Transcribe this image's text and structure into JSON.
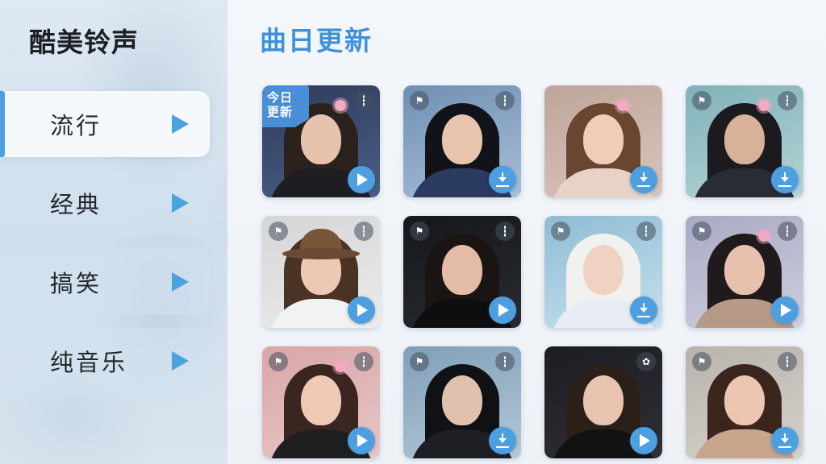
{
  "app": {
    "title": "酷美铃声"
  },
  "sidebar": {
    "items": [
      {
        "label": "流行",
        "active": true
      },
      {
        "label": "经典",
        "active": false
      },
      {
        "label": "搞笑",
        "active": false
      },
      {
        "label": "纯音乐",
        "active": false
      }
    ]
  },
  "main": {
    "section_title": "曲日更新",
    "badge_line1": "今日",
    "badge_line2": "更新",
    "cards": [
      {
        "action": "play",
        "left_icon": "",
        "right_icon": "mute-icon",
        "bg": [
          "#2f3a5a",
          "#4a5f86"
        ],
        "hair": "#2b211d",
        "skin": "#e7c2ad",
        "cloth": "#1e1e22",
        "hat": false,
        "flower": true
      },
      {
        "action": "download",
        "left_icon": "flag-icon",
        "right_icon": "mute-icon",
        "bg": [
          "#6f8fb3",
          "#a8c0d8"
        ],
        "hair": "#111318",
        "skin": "#e6c4ae",
        "cloth": "#2a3a60",
        "hat": false,
        "flower": false
      },
      {
        "action": "download",
        "left_icon": "",
        "right_icon": "",
        "bg": [
          "#bfa59b",
          "#d8c5bc"
        ],
        "hair": "#6a4530",
        "skin": "#efcdb8",
        "cloth": "#e8d2c5",
        "hat": false,
        "flower": true
      },
      {
        "action": "download",
        "left_icon": "flag-icon",
        "right_icon": "mute-icon",
        "bg": [
          "#7fb1b8",
          "#b4d5d6"
        ],
        "hair": "#1b1b1f",
        "skin": "#d9b09a",
        "cloth": "#2a2c33",
        "hat": false,
        "flower": true
      },
      {
        "action": "play",
        "left_icon": "flag-icon",
        "right_icon": "mute-icon",
        "bg": [
          "#d5d5d5",
          "#ececec"
        ],
        "hair": "#4a3224",
        "skin": "#ecc9b4",
        "cloth": "#f2f2f2",
        "hat": true,
        "flower": false
      },
      {
        "action": "play",
        "left_icon": "flag-icon",
        "right_icon": "mute-icon",
        "bg": [
          "#16171b",
          "#2a2b30"
        ],
        "hair": "#1a1412",
        "skin": "#e3bba6",
        "cloth": "#0e0e10",
        "hat": false,
        "flower": false
      },
      {
        "action": "download",
        "left_icon": "flag-icon",
        "right_icon": "mute-icon",
        "bg": [
          "#8fbcd4",
          "#c7e0ee"
        ],
        "hair": "#f1f1ef",
        "skin": "#f0d2c2",
        "cloth": "#e7edf2",
        "hat": false,
        "flower": false
      },
      {
        "action": "play",
        "left_icon": "flag-icon",
        "right_icon": "mute-icon",
        "bg": [
          "#a9a9c2",
          "#cfcfe0"
        ],
        "hair": "#201a1c",
        "skin": "#e7c1ad",
        "cloth": "#b79a86",
        "hat": false,
        "flower": true
      },
      {
        "action": "play",
        "left_icon": "flag-icon",
        "right_icon": "mute-icon",
        "bg": [
          "#d8a6a8",
          "#e9c6c6"
        ],
        "hair": "#3a2620",
        "skin": "#efc9b6",
        "cloth": "#1f1f22",
        "hat": false,
        "flower": true
      },
      {
        "action": "download",
        "left_icon": "flag-icon",
        "right_icon": "mute-icon",
        "bg": [
          "#7f9fb8",
          "#b4c8d8"
        ],
        "hair": "#0f1114",
        "skin": "#e0c1ad",
        "cloth": "#1e1f24",
        "hat": false,
        "flower": false
      },
      {
        "action": "play",
        "left_icon": "",
        "right_icon": "flower-icon",
        "bg": [
          "#1c1d22",
          "#2f3036"
        ],
        "hair": "#2b1f1a",
        "skin": "#e8c3ad",
        "cloth": "#121215",
        "hat": false,
        "flower": false
      },
      {
        "action": "download",
        "left_icon": "flag-icon",
        "right_icon": "mute-icon",
        "bg": [
          "#b9b3ad",
          "#d6d1cb"
        ],
        "hair": "#3b261d",
        "skin": "#ecc6b1",
        "cloth": "#c9a58d",
        "hat": false,
        "flower": false
      }
    ]
  }
}
